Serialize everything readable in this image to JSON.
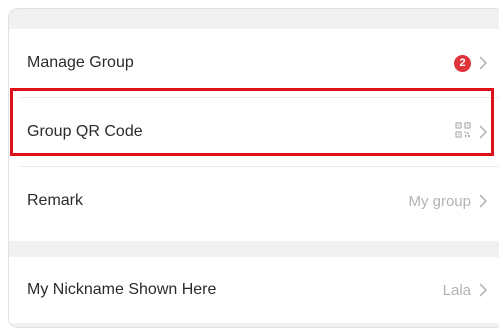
{
  "settings": {
    "items": [
      {
        "label": "Manage Group",
        "badge": "2",
        "icon": "chevron-right-icon"
      },
      {
        "label": "Group QR Code",
        "icon": "qr-code-icon"
      },
      {
        "label": "Remark",
        "value": "My group",
        "icon": "chevron-right-icon"
      }
    ],
    "nickname": {
      "label": "My Nickname Shown Here",
      "value": "Lala"
    }
  },
  "colors": {
    "badge": "#e0333a",
    "highlight": "#e0101a",
    "background": "#f1f1f1"
  }
}
